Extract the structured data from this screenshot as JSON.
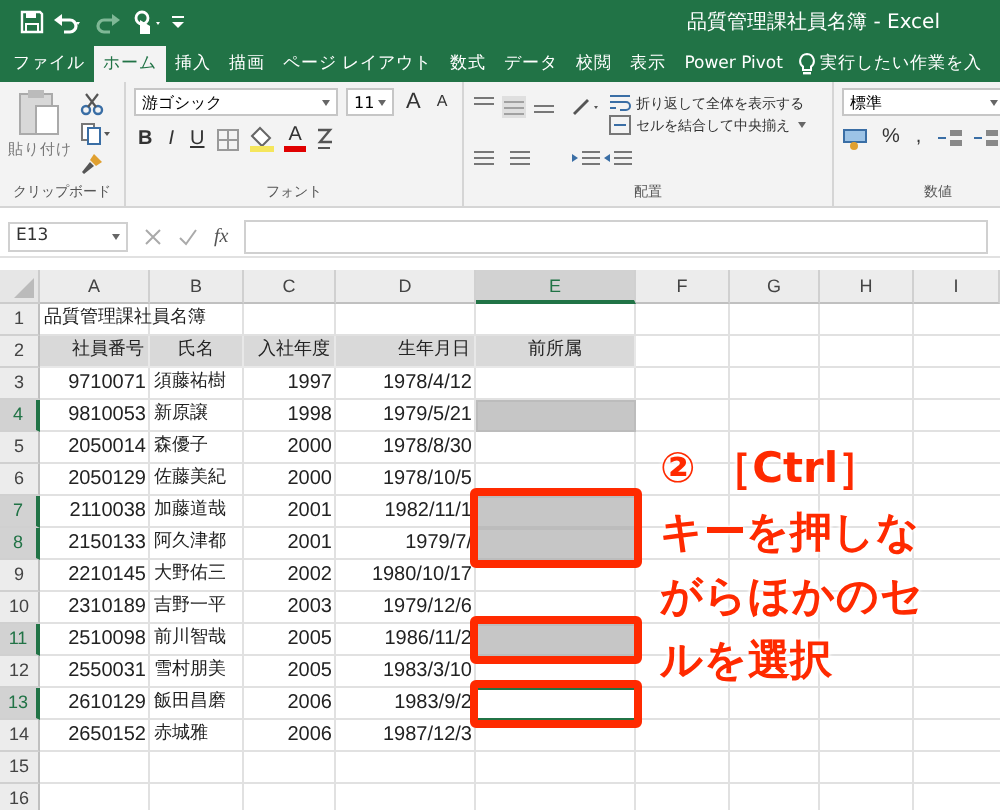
{
  "title_bar": {
    "title": "品質管理課社員名簿 - Excel"
  },
  "ribbon_tabs": [
    {
      "label": "ファイル",
      "selected": false
    },
    {
      "label": "ホーム",
      "selected": true
    },
    {
      "label": "挿入",
      "selected": false
    },
    {
      "label": "描画",
      "selected": false
    },
    {
      "label": "ページ レイアウト",
      "selected": false
    },
    {
      "label": "数式",
      "selected": false
    },
    {
      "label": "データ",
      "selected": false
    },
    {
      "label": "校閲",
      "selected": false
    },
    {
      "label": "表示",
      "selected": false
    },
    {
      "label": "Power Pivot",
      "selected": false
    }
  ],
  "tell_me": {
    "placeholder": "実行したい作業を入"
  },
  "ribbon": {
    "clipboard": {
      "paste": "貼り付け",
      "label": "クリップボード"
    },
    "font": {
      "font_name": "游ゴシック",
      "font_size": "11",
      "grow": "A",
      "shrink": "A",
      "bold": "B",
      "italic": "I",
      "underline": "U",
      "font_color": "A",
      "label": "フォント"
    },
    "alignment": {
      "wrap_text": "折り返して全体を表示する",
      "merge_center": "セルを結合して中央揃え",
      "label": "配置"
    },
    "number": {
      "format": "標準",
      "percent": "%",
      "comma": ",",
      "label": "数値"
    }
  },
  "formula_bar": {
    "name_box": "E13",
    "fx": "fx"
  },
  "columns": [
    {
      "label": "A",
      "selected": false
    },
    {
      "label": "B",
      "selected": false
    },
    {
      "label": "C",
      "selected": false
    },
    {
      "label": "D",
      "selected": false
    },
    {
      "label": "E",
      "selected": true
    },
    {
      "label": "F",
      "selected": false
    },
    {
      "label": "G",
      "selected": false
    },
    {
      "label": "H",
      "selected": false
    },
    {
      "label": "I",
      "selected": false
    }
  ],
  "rows": [
    {
      "number": "1",
      "kind": "title",
      "cells": [
        "品質管理課社員名簿"
      ],
      "selected": false,
      "active": false,
      "framed": false
    },
    {
      "number": "2",
      "kind": "header",
      "cells": [
        "社員番号",
        "氏名",
        "入社年度",
        "生年月日",
        "前所属"
      ],
      "selected": false,
      "active": false,
      "framed": false
    },
    {
      "number": "3",
      "kind": "data",
      "cells": [
        "9710071",
        "須藤祐樹",
        "1997",
        "1978/4/12"
      ],
      "selected": false,
      "active": false,
      "framed": false
    },
    {
      "number": "4",
      "kind": "data",
      "cells": [
        "9810053",
        "新原譲",
        "1998",
        "1979/5/21"
      ],
      "selected": true,
      "active": false,
      "framed": false
    },
    {
      "number": "5",
      "kind": "data",
      "cells": [
        "2050014",
        "森優子",
        "2000",
        "1978/8/30"
      ],
      "selected": false,
      "active": false,
      "framed": false
    },
    {
      "number": "6",
      "kind": "data",
      "cells": [
        "2050129",
        "佐藤美紀",
        "2000",
        "1978/10/5"
      ],
      "selected": false,
      "active": false,
      "framed": false
    },
    {
      "number": "7",
      "kind": "data",
      "cells": [
        "2110038",
        "加藤道哉",
        "2001",
        "1982/11/1"
      ],
      "selected": true,
      "active": false,
      "framed": true
    },
    {
      "number": "8",
      "kind": "data",
      "cells": [
        "2150133",
        "阿久津都",
        "2001",
        "1979/7/"
      ],
      "selected": true,
      "active": false,
      "framed": true
    },
    {
      "number": "9",
      "kind": "data",
      "cells": [
        "2210145",
        "大野佑三",
        "2002",
        "1980/10/17"
      ],
      "selected": false,
      "active": false,
      "framed": false
    },
    {
      "number": "10",
      "kind": "data",
      "cells": [
        "2310189",
        "吉野一平",
        "2003",
        "1979/12/6"
      ],
      "selected": false,
      "active": false,
      "framed": false
    },
    {
      "number": "11",
      "kind": "data",
      "cells": [
        "2510098",
        "前川智哉",
        "2005",
        "1986/11/2"
      ],
      "selected": true,
      "active": false,
      "framed": true
    },
    {
      "number": "12",
      "kind": "data",
      "cells": [
        "2550031",
        "雪村朋美",
        "2005",
        "1983/3/10"
      ],
      "selected": false,
      "active": false,
      "framed": false
    },
    {
      "number": "13",
      "kind": "data",
      "cells": [
        "2610129",
        "飯田昌磨",
        "2006",
        "1983/9/2"
      ],
      "selected": true,
      "active": true,
      "framed": true
    },
    {
      "number": "14",
      "kind": "data",
      "cells": [
        "2650152",
        "赤城雅",
        "2006",
        "1987/12/3"
      ],
      "selected": false,
      "active": false,
      "framed": false
    },
    {
      "number": "15",
      "kind": "empty",
      "cells": [],
      "selected": false,
      "active": false,
      "framed": false
    },
    {
      "number": "16",
      "kind": "empty",
      "cells": [],
      "selected": false,
      "active": false,
      "framed": false
    }
  ],
  "annotation": {
    "lines": [
      "② ［Ctrl］",
      "キーを押しな",
      "がらほかのセ",
      "ルを選択"
    ]
  }
}
